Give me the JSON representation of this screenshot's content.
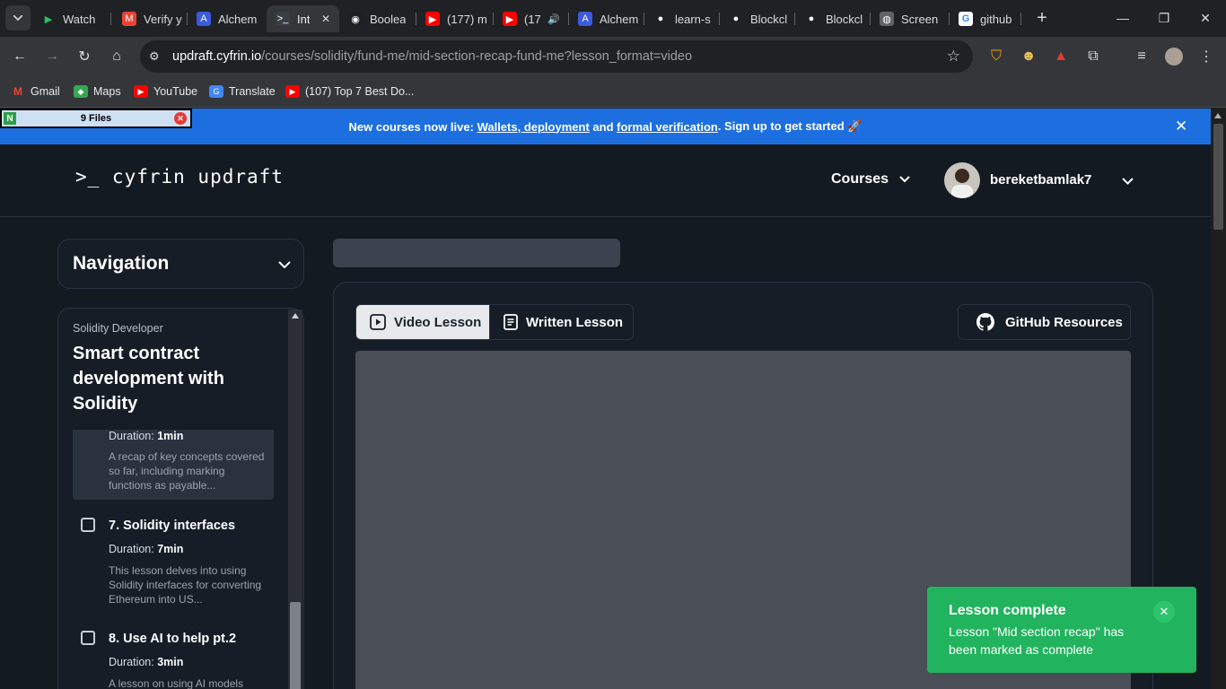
{
  "browser": {
    "tabs": [
      {
        "label": "Watch",
        "icon": "play-icon",
        "color": "#22c55e"
      },
      {
        "label": "Verify y",
        "icon": "gmail-icon",
        "color": "#ea4335"
      },
      {
        "label": "Alchem",
        "icon": "alchemy-icon",
        "color": "#3b5bdb"
      },
      {
        "label": "Int",
        "icon": "cyfrin-icon",
        "color": "#3a3f47"
      },
      {
        "label": "Boolea",
        "icon": "discord-icon",
        "color": "#1f1f1f"
      },
      {
        "label": "(177) m",
        "icon": "youtube-icon",
        "color": "#ff0000"
      },
      {
        "label": "(17",
        "icon": "youtube-icon",
        "color": "#ff0000"
      },
      {
        "label": "Alchem",
        "icon": "alchemy-icon",
        "color": "#3b5bdb"
      },
      {
        "label": "learn-s",
        "icon": "github-icon",
        "color": "#202124"
      },
      {
        "label": "Blockcl",
        "icon": "github-icon",
        "color": "#202124"
      },
      {
        "label": "Blockcl",
        "icon": "github-icon",
        "color": "#202124"
      },
      {
        "label": "Screen",
        "icon": "globe-icon",
        "color": "#5f6368"
      },
      {
        "label": "github",
        "icon": "google-icon",
        "color": "#ffffff"
      }
    ],
    "url_host": "updraft.cyfrin.io",
    "url_path": "/courses/solidity/fund-me/mid-section-recap-fund-me?lesson_format=video",
    "bookmarks": [
      {
        "label": "Gmail",
        "icon": "gmail-icon"
      },
      {
        "label": "Maps",
        "icon": "maps-icon"
      },
      {
        "label": "YouTube",
        "icon": "youtube-icon"
      },
      {
        "label": "Translate",
        "icon": "translate-icon"
      },
      {
        "label": "(107) Top 7 Best Do...",
        "icon": "youtube-icon"
      }
    ]
  },
  "overlay": {
    "files_label": "9 Files"
  },
  "banner": {
    "prefix": "New courses now live: ",
    "link1": "Wallets, deployment",
    "middle": " and ",
    "link2": "formal verification",
    "suffix": ". Sign up to get started 🚀"
  },
  "header": {
    "logo": ">_ cyfrin updraft",
    "courses_label": "Courses",
    "username": "bereketbamlak7"
  },
  "navigation": {
    "title": "Navigation"
  },
  "sidebar": {
    "course_kicker": "Solidity Developer",
    "course_title": "Smart contract development with Solidity",
    "current_lesson": {
      "duration_label": "Duration:",
      "duration": "1min",
      "description": "A recap of key concepts covered so far, including marking functions as payable..."
    },
    "lessons": [
      {
        "title": "7. Solidity interfaces",
        "duration_label": "Duration:",
        "duration": "7min",
        "description": "This lesson delves into using Solidity interfaces for converting Ethereum into US..."
      },
      {
        "title": "8. Use AI to help pt.2",
        "duration_label": "Duration:",
        "duration": "3min",
        "description": "A lesson on using AI models"
      }
    ]
  },
  "content": {
    "tab_video": "Video Lesson",
    "tab_written": "Written Lesson",
    "github_button": "GitHub Resources"
  },
  "toast": {
    "title": "Lesson complete",
    "message": "Lesson \"Mid section recap\" has been marked as complete"
  },
  "colors": {
    "banner": "#1d6fe0",
    "toast": "#22b35e",
    "page_bg": "#141a22"
  }
}
